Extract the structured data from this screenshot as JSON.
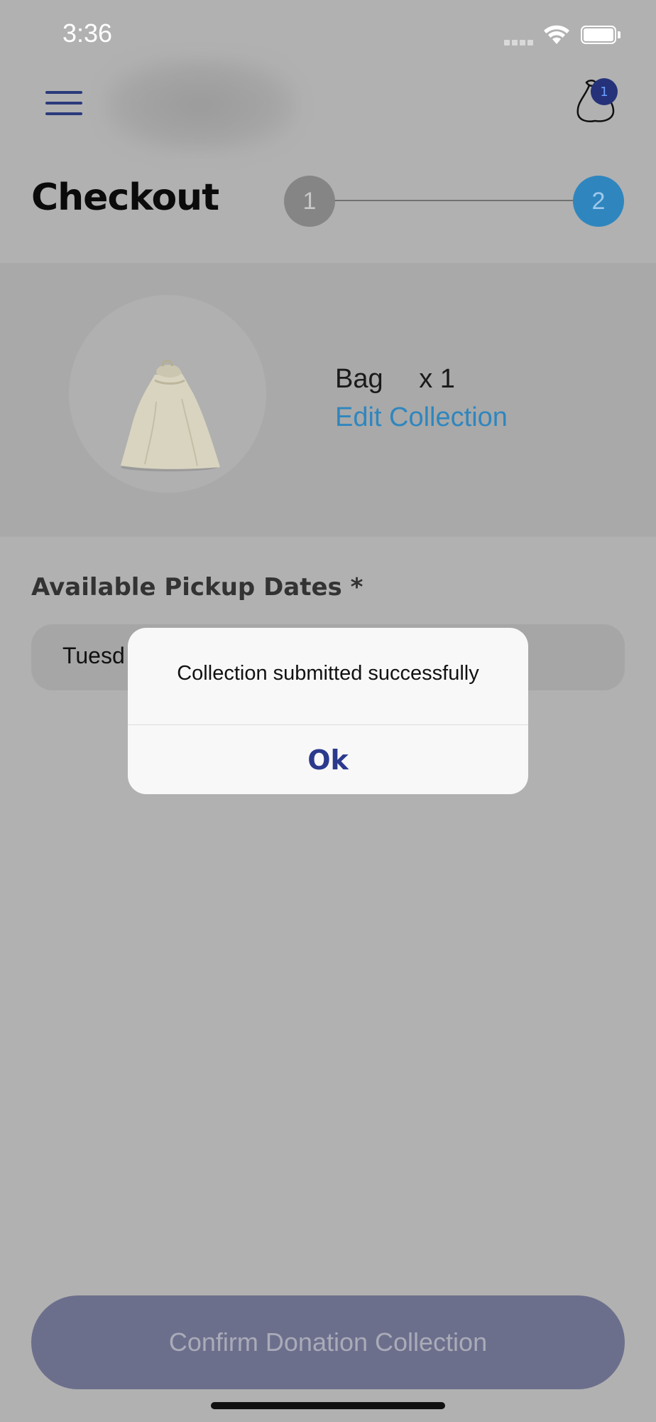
{
  "status_bar": {
    "time": "3:36"
  },
  "header": {
    "cart_count": "1"
  },
  "checkout": {
    "title": "Checkout",
    "steps": [
      {
        "label": "1"
      },
      {
        "label": "2"
      }
    ],
    "active_step": 2
  },
  "item": {
    "name": "Bag",
    "quantity": "x 1",
    "edit_label": "Edit Collection"
  },
  "pickup": {
    "label": "Available Pickup Dates *",
    "selected_value": "Tuesd"
  },
  "confirm_button": {
    "label": "Confirm Donation Collection"
  },
  "alert": {
    "message": "Collection submitted successfully",
    "ok_label": "Ok"
  },
  "colors": {
    "brand_navy": "#2b3a7c",
    "accent_blue": "#2f86be",
    "overlay_gray": "#b1b1b1"
  }
}
